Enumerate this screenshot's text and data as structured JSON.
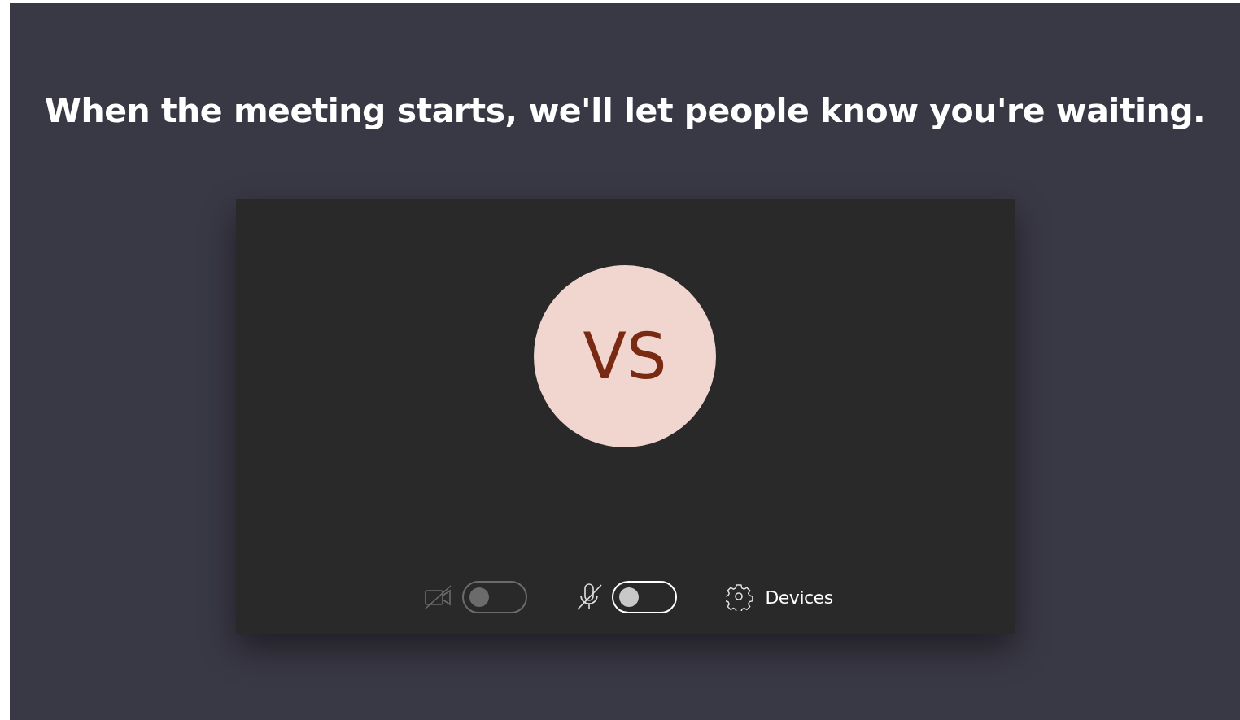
{
  "heading": "When the meeting starts, we'll let people know you're waiting.",
  "preview": {
    "avatar": {
      "initials": "VS"
    }
  },
  "controls": [
    {
      "kind": "camera",
      "on": false,
      "disabled": true
    },
    {
      "kind": "microphone",
      "on": false,
      "disabled": false
    }
  ],
  "devices_button": {
    "label": "Devices"
  }
}
